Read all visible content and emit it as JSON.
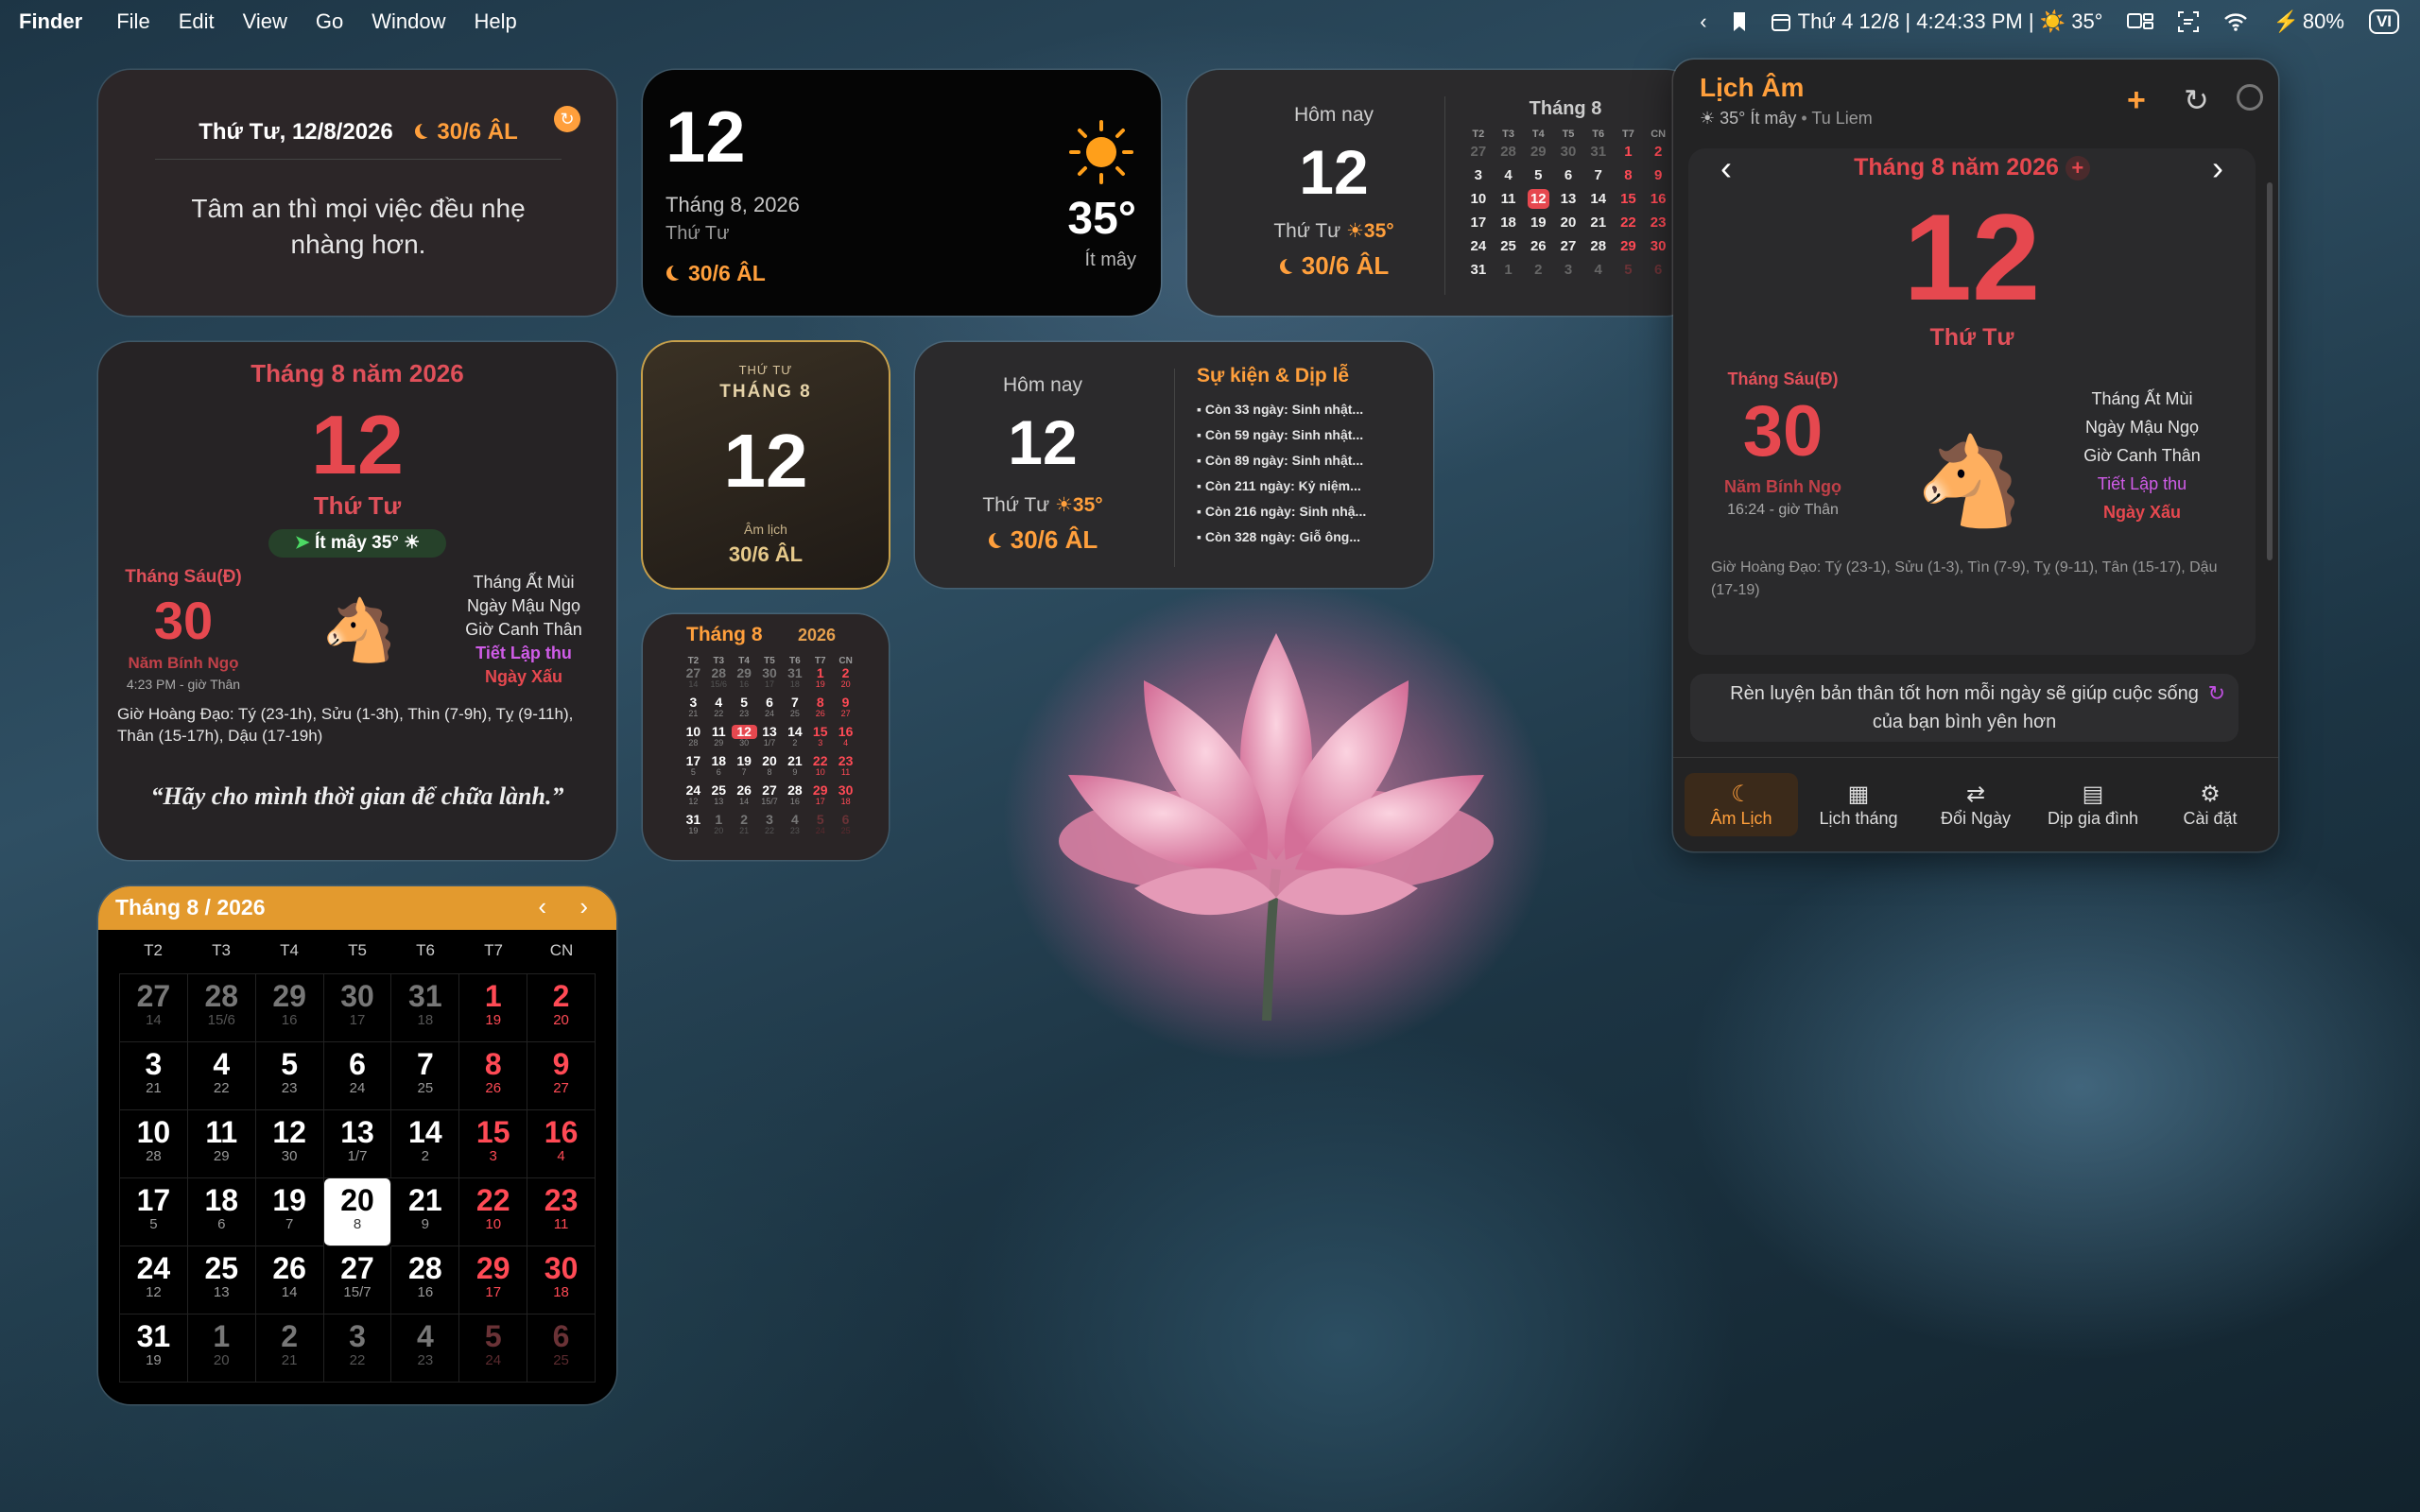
{
  "menubar": {
    "app": "Finder",
    "items": [
      "File",
      "Edit",
      "View",
      "Go",
      "Window",
      "Help"
    ],
    "status": "Thứ 4 12/8 | 4:24:33 PM | ☀️ 35°",
    "battery": "80%",
    "input": "VI"
  },
  "w1": {
    "date": "Thứ Tư, 12/8/2026",
    "lunar": "30/6 ÂL",
    "quote": "Tâm an thì mọi việc đều nhẹ nhàng hơn."
  },
  "w2": {
    "day": "12",
    "month": "Tháng 8, 2026",
    "weekday": "Thứ Tư",
    "temp": "35°",
    "cond": "Ít mây",
    "lunar": "30/6 ÂL"
  },
  "w3": {
    "today": "Hôm nay",
    "day": "12",
    "weekday": "Thứ Tư",
    "temp": "35°",
    "lunar": "30/6 ÂL",
    "month": "Tháng 8",
    "weekdays": [
      "T2",
      "T3",
      "T4",
      "T5",
      "T6",
      "T7",
      "CN"
    ],
    "days": [
      [
        "27",
        "28",
        "29",
        "30",
        "31",
        "1",
        "2"
      ],
      [
        "3",
        "4",
        "5",
        "6",
        "7",
        "8",
        "9"
      ],
      [
        "10",
        "11",
        "12",
        "13",
        "14",
        "15",
        "16"
      ],
      [
        "17",
        "18",
        "19",
        "20",
        "21",
        "22",
        "23"
      ],
      [
        "24",
        "25",
        "26",
        "27",
        "28",
        "29",
        "30"
      ],
      [
        "31",
        "1",
        "2",
        "3",
        "4",
        "5",
        "6"
      ]
    ]
  },
  "w4": {
    "title": "Tháng 8 năm 2026",
    "day": "12",
    "weekday": "Thứ Tư",
    "weather": "Ít mây 35°",
    "lunar_month": "Tháng Sáu(Đ)",
    "lunar_day": "30",
    "lunar_year": "Năm Bính Ngọ",
    "time": "4:23 PM - giờ Thân",
    "can_chi": [
      "Tháng Ất Mùi",
      "Ngày Mậu Ngọ",
      "Giờ Canh Thân"
    ],
    "tiet": "Tiết Lập thu",
    "quality": "Ngày Xấu",
    "hoang_dao": "Giờ Hoàng Đạo: Tý (23-1h), Sửu (1-3h), Thìn (7-9h), Tỵ (9-11h), Thân (15-17h), Dậu (17-19h)",
    "quote": "“Hãy cho mình thời gian để chữa lành.”"
  },
  "w5": {
    "weekday": "THỨ TƯ",
    "month": "THÁNG 8",
    "day": "12",
    "lunar_label": "Âm lịch",
    "lunar": "30/6 ÂL"
  },
  "w6": {
    "today": "Hôm nay",
    "day": "12",
    "weekday": "Thứ Tư",
    "temp": "35°",
    "lunar": "30/6 ÂL",
    "events_title": "Sự kiện & Dịp lễ",
    "events": [
      "Còn 33 ngày: Sinh nhật...",
      "Còn 59 ngày: Sinh nhật...",
      "Còn 89 ngày: Sinh nhật...",
      "Còn 211 ngày: Kỷ niệm...",
      "Còn 216 ngày: Sinh nhậ...",
      "Còn 328 ngày: Giỗ ông..."
    ]
  },
  "w7": {
    "month": "Tháng 8",
    "year": "2026",
    "weekdays": [
      "T2",
      "T3",
      "T4",
      "T5",
      "T6",
      "T7",
      "CN"
    ],
    "rows": [
      [
        [
          "27",
          "14"
        ],
        [
          "28",
          "15/6"
        ],
        [
          "29",
          "16"
        ],
        [
          "30",
          "17"
        ],
        [
          "31",
          "18"
        ],
        [
          "1",
          "19"
        ],
        [
          "2",
          "20"
        ]
      ],
      [
        [
          "3",
          "21"
        ],
        [
          "4",
          "22"
        ],
        [
          "5",
          "23"
        ],
        [
          "6",
          "24"
        ],
        [
          "7",
          "25"
        ],
        [
          "8",
          "26"
        ],
        [
          "9",
          "27"
        ]
      ],
      [
        [
          "10",
          "28"
        ],
        [
          "11",
          "29"
        ],
        [
          "12",
          "30"
        ],
        [
          "13",
          "1/7"
        ],
        [
          "14",
          "2"
        ],
        [
          "15",
          "3"
        ],
        [
          "16",
          "4"
        ]
      ],
      [
        [
          "17",
          "5"
        ],
        [
          "18",
          "6"
        ],
        [
          "19",
          "7"
        ],
        [
          "20",
          "8"
        ],
        [
          "21",
          "9"
        ],
        [
          "22",
          "10"
        ],
        [
          "23",
          "11"
        ]
      ],
      [
        [
          "24",
          "12"
        ],
        [
          "25",
          "13"
        ],
        [
          "26",
          "14"
        ],
        [
          "27",
          "15/7"
        ],
        [
          "28",
          "16"
        ],
        [
          "29",
          "17"
        ],
        [
          "30",
          "18"
        ]
      ],
      [
        [
          "31",
          "19"
        ],
        [
          "1",
          "20"
        ],
        [
          "2",
          "21"
        ],
        [
          "3",
          "22"
        ],
        [
          "4",
          "23"
        ],
        [
          "5",
          "24"
        ],
        [
          "6",
          "25"
        ]
      ]
    ]
  },
  "w8": {
    "title": "Tháng 8 / 2026",
    "weekdays": [
      "T2",
      "T3",
      "T4",
      "T5",
      "T6",
      "T7",
      "CN"
    ]
  },
  "popover": {
    "title": "Lịch Âm",
    "subtitle": "35° Ít mây",
    "location": "Tu Liem",
    "month_title": "Tháng 8 năm 2026",
    "day": "12",
    "weekday": "Thứ Tư",
    "lunar_month": "Tháng Sáu(Đ)",
    "lunar_day": "30",
    "lunar_year": "Năm Bính Ngọ",
    "time": "16:24 - giờ Thân",
    "can_chi": [
      "Tháng Ất Mùi",
      "Ngày Mậu Ngọ",
      "Giờ Canh Thân"
    ],
    "tiet": "Tiết Lập thu",
    "quality": "Ngày Xấu",
    "hoang_dao": "Giờ Hoàng Đạo: Tý (23-1), Sửu (1-3), Tìn (7-9), Tỵ (9-11), Tân (15-17), Dậu (17-19)",
    "quote": "Rèn luyện bản thân tốt hơn mỗi ngày sẽ giúp cuộc sống của bạn bình yên hơn",
    "tabs": [
      "Âm Lịch",
      "Lịch tháng",
      "Đổi Ngày",
      "Dịp gia đình",
      "Cài đặt"
    ]
  },
  "colors": {
    "accent": "#ff9f3c",
    "red": "#e6484f",
    "purple": "#d05ce8"
  }
}
